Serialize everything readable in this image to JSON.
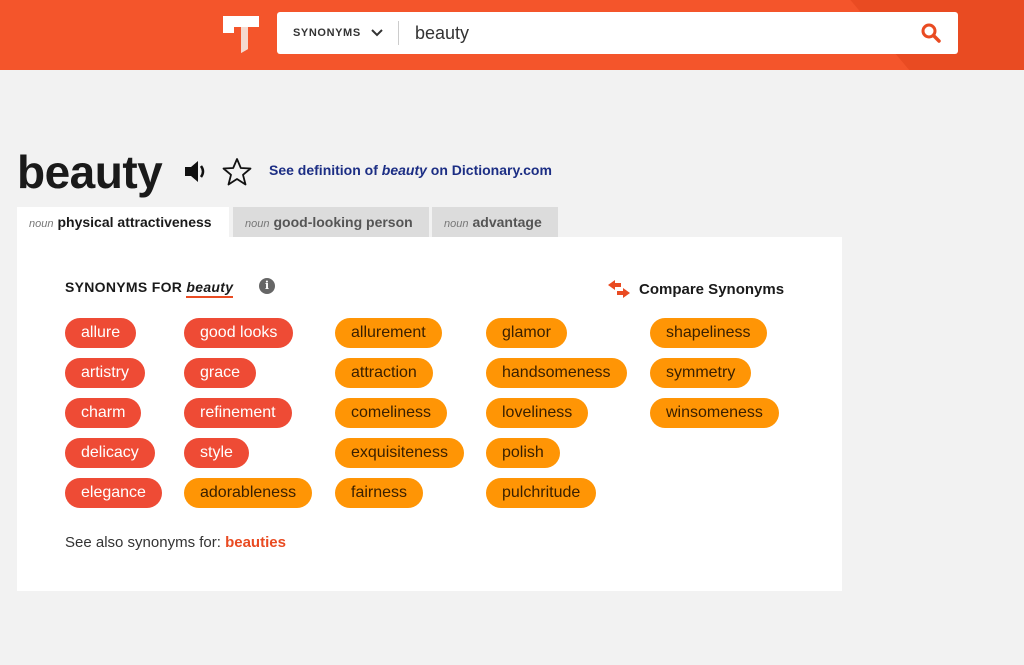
{
  "header": {
    "search_type": "SYNONYMS",
    "search_value": "beauty"
  },
  "entry": {
    "word": "beauty",
    "definition_link": {
      "prefix": "See definition of ",
      "word": "beauty",
      "suffix": " on Dictionary.com"
    }
  },
  "tabs": [
    {
      "pos": "noun",
      "label": "physical attractiveness",
      "active": true
    },
    {
      "pos": "noun",
      "label": "good-looking person",
      "active": false
    },
    {
      "pos": "noun",
      "label": "advantage",
      "active": false
    }
  ],
  "panel": {
    "title_prefix": "SYNONYMS FOR",
    "title_word": "beauty",
    "info_glyph": "i",
    "compare_label": "Compare Synonyms",
    "columns": [
      [
        {
          "text": "allure",
          "color": "red"
        },
        {
          "text": "artistry",
          "color": "red"
        },
        {
          "text": "charm",
          "color": "red"
        },
        {
          "text": "delicacy",
          "color": "red"
        },
        {
          "text": "elegance",
          "color": "red"
        }
      ],
      [
        {
          "text": "good looks",
          "color": "red"
        },
        {
          "text": "grace",
          "color": "red"
        },
        {
          "text": "refinement",
          "color": "red"
        },
        {
          "text": "style",
          "color": "red"
        },
        {
          "text": "adorableness",
          "color": "orange"
        }
      ],
      [
        {
          "text": "allurement",
          "color": "orange"
        },
        {
          "text": "attraction",
          "color": "orange"
        },
        {
          "text": "comeliness",
          "color": "orange"
        },
        {
          "text": "exquisiteness",
          "color": "orange"
        },
        {
          "text": "fairness",
          "color": "orange"
        }
      ],
      [
        {
          "text": "glamor",
          "color": "orange"
        },
        {
          "text": "handsomeness",
          "color": "orange"
        },
        {
          "text": "loveliness",
          "color": "orange"
        },
        {
          "text": "polish",
          "color": "orange"
        },
        {
          "text": "pulchritude",
          "color": "orange"
        }
      ],
      [
        {
          "text": "shapeliness",
          "color": "orange"
        },
        {
          "text": "symmetry",
          "color": "orange"
        },
        {
          "text": "winsomeness",
          "color": "orange"
        }
      ]
    ],
    "see_also_prefix": "See also synonyms for:",
    "see_also_word": "beauties"
  },
  "colors": {
    "brand": "#f4552b",
    "pill_red": "#ee4b35",
    "pill_orange": "#ff9505",
    "link_blue": "#1c2e84"
  }
}
